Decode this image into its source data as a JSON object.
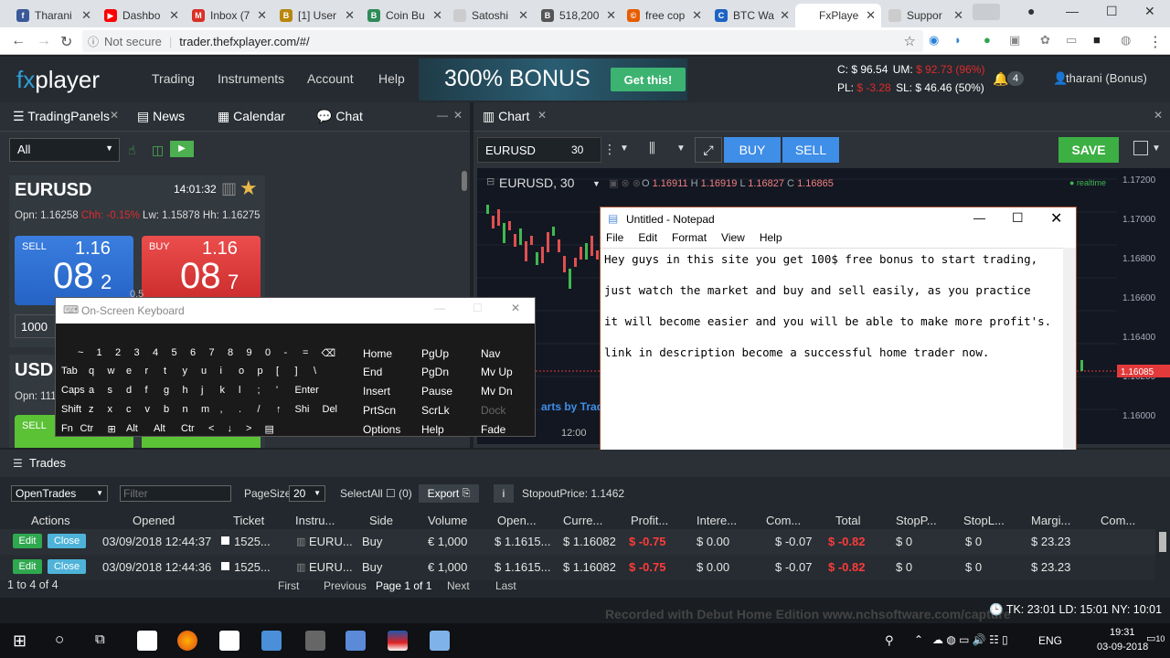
{
  "browser": {
    "tabs": [
      {
        "label": "Tharani",
        "color": "#3b5998",
        "glyph": "f"
      },
      {
        "label": "Dashbo",
        "color": "#ff0000",
        "glyph": "▶"
      },
      {
        "label": "Inbox (7",
        "color": "#d93025",
        "glyph": "M"
      },
      {
        "label": "[1] User",
        "color": "#b8860b",
        "glyph": "B"
      },
      {
        "label": "Coin Bu",
        "color": "#2e8b57",
        "glyph": "B"
      },
      {
        "label": "Satoshi",
        "color": "#cccccc",
        "glyph": ""
      },
      {
        "label": "518,200",
        "color": "#555555",
        "glyph": "B"
      },
      {
        "label": "free cop",
        "color": "#e65c00",
        "glyph": "©"
      },
      {
        "label": "BTC Wa",
        "color": "#1e63c4",
        "glyph": "C"
      },
      {
        "label": "FxPlaye",
        "color": "#ffffff",
        "glyph": ""
      },
      {
        "label": "Suppor",
        "color": "#cccccc",
        "glyph": ""
      }
    ],
    "security": "Not secure",
    "url": "trader.thefxplayer.com/#/"
  },
  "header": {
    "logo_fx": "fx",
    "logo_player": "player",
    "menu": [
      "Trading",
      "Instruments",
      "Account",
      "Help"
    ],
    "banner_text": "300% BONUS",
    "banner_button": "Get this!",
    "account_c_label": "C: $ 96.54",
    "account_um_label": "UM:",
    "account_um_value": "$ 92.73 (96%)",
    "account_pl_label": "PL:",
    "account_pl_value": "$ -3.28",
    "account_sl": "SL: $ 46.46 (50%)",
    "notifications": "4",
    "user": "tharani (Bonus)"
  },
  "left_panel": {
    "tabs": [
      "TradingPanels",
      "News",
      "Calendar",
      "Chat"
    ],
    "filter": "All",
    "quote1": {
      "symbol": "EURUSD",
      "time": "14:01:32",
      "opn": "Opn: 1.16258",
      "chg": "Chh: -0.15%",
      "lw": "Lw: 1.15878",
      "hh": "Hh: 1.16275",
      "sell_label": "SELL",
      "sell_big": "1.16",
      "sell_pips": "08",
      "sell_frac": "2",
      "buy_label": "BUY",
      "buy_big": "1.16",
      "buy_pips": "08",
      "buy_frac": "7",
      "spread": "0.5",
      "amount": "1000"
    },
    "quote2": {
      "symbol": "USD",
      "opn": "Opn: 111",
      "sell_label": "SELL"
    }
  },
  "keyboard": {
    "title": "On-Screen Keyboard",
    "rows": [
      [
        "~",
        "1",
        "2",
        "3",
        "4",
        "5",
        "6",
        "7",
        "8",
        "9",
        "0",
        "-",
        "=",
        "⌫"
      ],
      [
        "Tab",
        "q",
        "w",
        "e",
        "r",
        "t",
        "y",
        "u",
        "i",
        "o",
        "p",
        "[",
        "]",
        "\\"
      ],
      [
        "Caps",
        "a",
        "s",
        "d",
        "f",
        "g",
        "h",
        "j",
        "k",
        "l",
        ";",
        "'",
        "Enter"
      ],
      [
        "Shift",
        "z",
        "x",
        "c",
        "v",
        "b",
        "n",
        "m",
        ",",
        ".",
        "/",
        "↑",
        "Shi",
        "Del"
      ],
      [
        "Fn",
        "Ctr",
        "⊞",
        "Alt",
        "Alt",
        "Ctr",
        "<",
        "↓",
        ">",
        "▤"
      ]
    ],
    "nav": [
      [
        "Home",
        "PgUp",
        "Nav"
      ],
      [
        "End",
        "PgDn",
        "Mv Up"
      ],
      [
        "Insert",
        "Pause",
        "Mv Dn"
      ],
      [
        "PrtScn",
        "ScrLk",
        "Dock"
      ],
      [
        "Options",
        "Help",
        "Fade"
      ]
    ]
  },
  "chart": {
    "tab": "Chart",
    "symbol": "EURUSD",
    "interval": "30",
    "buy": "BUY",
    "sell": "SELL",
    "save": "SAVE",
    "legend_symbol": "EURUSD, 30",
    "o": "1.16911",
    "h": "1.16919",
    "l": "1.16827",
    "c": "1.16865",
    "realtime": "realtime",
    "price_labels": [
      "1.17200",
      "1.17000",
      "1.16800",
      "1.16600",
      "1.16400",
      "1.16200",
      "1.16000",
      "1.15800"
    ],
    "current_price": "1.16085",
    "time_label": "12:00",
    "credit": "arts by Tradi"
  },
  "notepad": {
    "title": "Untitled - Notepad",
    "menu": [
      "File",
      "Edit",
      "Format",
      "View",
      "Help"
    ],
    "lines": [
      "Hey guys in this site you get 100$ free bonus to start trading,",
      "just watch the market and buy and sell easily, as you practice",
      "it will become easier and you will be able to make more profit's.",
      "link in description become a successful home trader now."
    ]
  },
  "trades": {
    "title": "Trades",
    "mode": "OpenTrades",
    "filter_placeholder": "Filter",
    "pagesize_label": "PageSize:",
    "pagesize": "20",
    "selectall": "SelectAll ☐ (0)",
    "export": "Export",
    "info": "i",
    "stopout": "StopoutPrice: 1.1462",
    "columns": [
      "Actions",
      "Opened",
      "Ticket",
      "Instru...",
      "Side",
      "Volume",
      "Open...",
      "Curre...",
      "Profit...",
      "Intere...",
      "Com...",
      "Total",
      "StopP...",
      "StopL...",
      "Margi...",
      "Com..."
    ],
    "rows": [
      [
        "03/09/2018 12:44:37",
        "1525...",
        "EURU...",
        "Buy",
        "€ 1,000",
        "$ 1.1615...",
        "$ 1.16082",
        "$ -0.75",
        "$ 0.00",
        "$ -0.07",
        "$ -0.82",
        "$ 0",
        "$ 0",
        "$ 23.23"
      ],
      [
        "03/09/2018 12:44:36",
        "1525...",
        "EURU...",
        "Buy",
        "€ 1,000",
        "$ 1.1615...",
        "$ 1.16082",
        "$ -0.75",
        "$ 0.00",
        "$ -0.07",
        "$ -0.82",
        "$ 0",
        "$ 0",
        "$ 23.23"
      ]
    ],
    "edit": "Edit",
    "close": "Close",
    "count": "1 to 4 of 4",
    "first": "First",
    "previous": "Previous",
    "page": "Page 1 of 1",
    "next": "Next",
    "last": "Last"
  },
  "status": {
    "clocks": "TK: 23:01 LD: 15:01 NY: 10:01",
    "recorder": "Recorded with Debut Home Edition  www.nchsoftware.com/capture"
  },
  "taskbar": {
    "time": "19:31",
    "date": "03-09-2018",
    "lang": "ENG",
    "notif": "10"
  }
}
